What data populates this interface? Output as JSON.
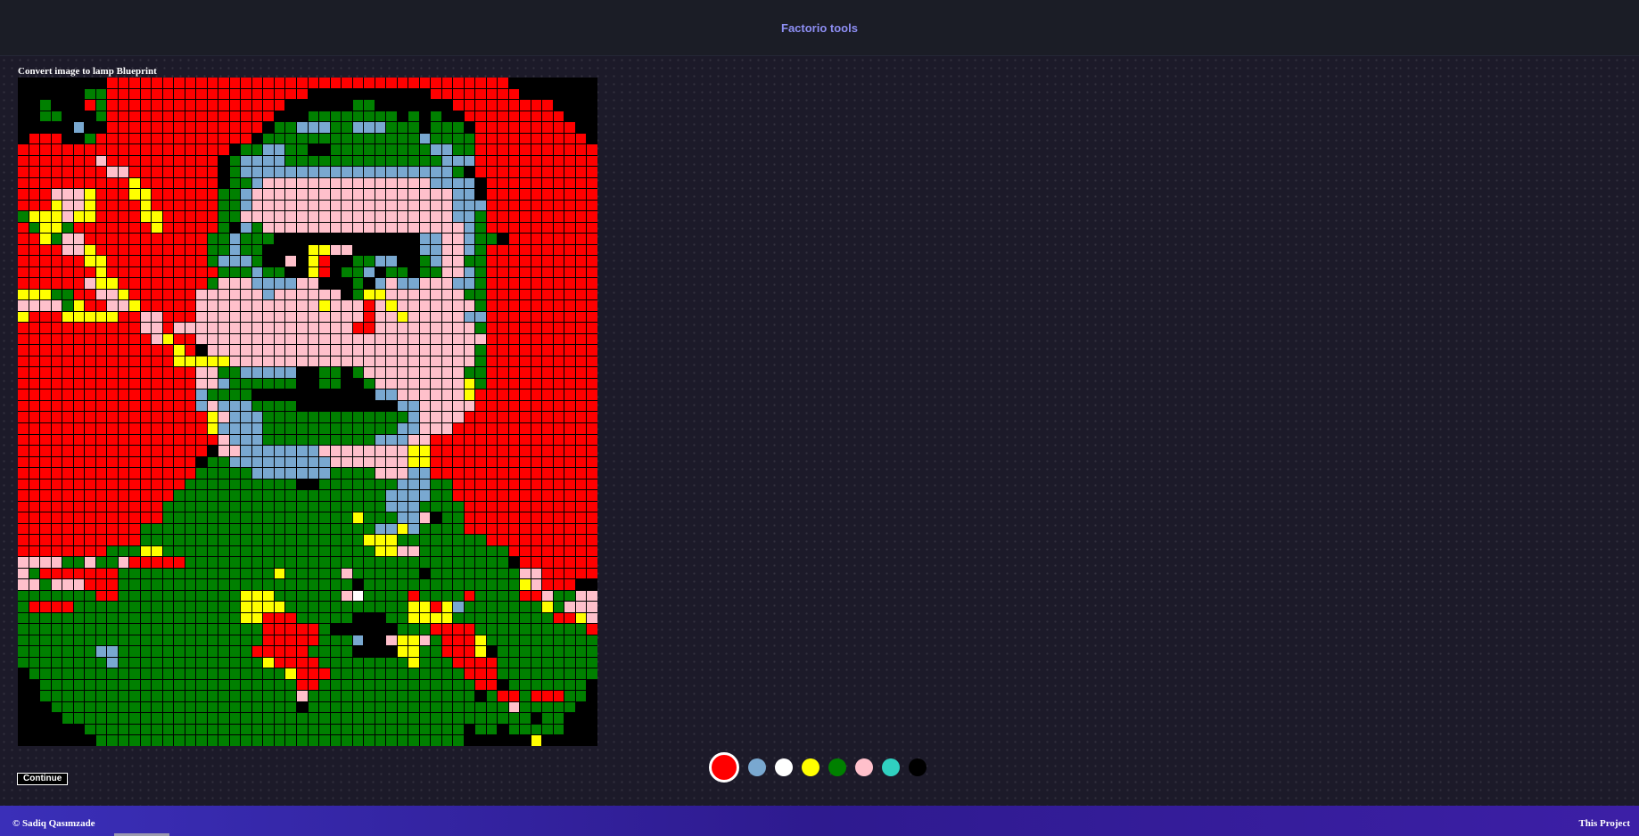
{
  "header": {
    "title": "Factorio tools"
  },
  "section": {
    "title": "Convert image to lamp Blueprint"
  },
  "actions": {
    "continue_label": "Continue"
  },
  "palette": {
    "colors": [
      {
        "name": "red",
        "hex": "#ff0000",
        "selected": true
      },
      {
        "name": "light-blue",
        "hex": "#79a8d0",
        "selected": false
      },
      {
        "name": "white",
        "hex": "#ffffff",
        "selected": false
      },
      {
        "name": "yellow",
        "hex": "#ffff00",
        "selected": false
      },
      {
        "name": "green",
        "hex": "#008000",
        "selected": false
      },
      {
        "name": "pink",
        "hex": "#ffc0cb",
        "selected": false
      },
      {
        "name": "cyan",
        "hex": "#30d0c0",
        "selected": false
      },
      {
        "name": "black",
        "hex": "#000000",
        "selected": false
      }
    ]
  },
  "lamp_grid": {
    "cols": 52,
    "rows": 60,
    "key": {
      "R": "#ff0000",
      "G": "#008000",
      "B": "#79a8d0",
      "Y": "#ffff00",
      "P": "#ffc0cb",
      "W": "#ffffff",
      "K": "#000000"
    },
    "cells": [
      "KKKKKKKKRRRRRRRRRRRRRRRRRRRRRRRRRRRRRRRRRRRRKKKKKKKK",
      "KKKKKKGGRRRRRRRRRRRRRRRRRRKKKKKKKKKKKRRRRRRRRKKKKKKK",
      "KKGKKKRGRRRRRRRRRRRRRRRRKKKKKKGGKKKKKKKRRRRRRRRRKKKK",
      "KKGGKKKGRRRRRRRRRRRRRRRKKKGGGGGGGGKGKGKKRRRRRRRRRKKK",
      "KKKKKBKKRRRRRRRRRRRRRRKGGBBBGGBBBGGGKGGGKRRRRRRRRRKK",
      "KRRRKKGRRRRRRRRRRRRRRKGGGGGGGGGGGGGGBGGGGRRRRRRRRRRK",
      "RRRRRRRRRRRRRRRRRRRKGGBBGGKKGGGGGGGGGBBGGRRRRRRRRRRR",
      "RRRRRRRPRRRRRRRRRRKGBBBBGGGGGGGGGGGGGGBBBRRRRRRRRRRR",
      "RRRRRRRRPPRRRRRRRRKGBBBBBBBBBBBBBBBBBBBGKRRRRRRRRRRR",
      "RRRRRRRRRRYRRRRRRRKGGBPPPPPPPPPPPPPPPBBBBKRRRRRRRRRR",
      "RRRPPPYRRRYYRRRRRRGGBPPPPPPPPPPPPPPPPPPBBKRRRRRRRRRR",
      "RRRYPPYRRRRYRRRRRRGGBPPPPPPPPPPPPPPPPPPBBBRRRRRRRRRR",
      "GYYYPYYRRRRYYRRRRRGGPPPPPPPPPPPPPPPPPPPBBGRRRRRRRRRR",
      "RGYYGRRRRRRRYRRRRRGKBGPPPPPPPPPPPPPPPPPPBGRRRRRRRRRR",
      "RRYGPPRRRRRRRRRRRGGBGGGKKKKKKKKKKKKKBBPPBGGKRRRRRRRR",
      "RRRRPPYRRRRRRRRRRGGBGGKKKKYYPPKKKKKKBBPPBGRRRRRRRRRR",
      "RRRRRRYYRRRRRRRRRGBBBGKKPKYRKKGGBBKKGBPPGGRRRRRRRRRR",
      "RRRRRRRYRRRRRRRRRRGGGBGGKKYRKGGBKGGKGGPPBGRRRRRRRRRR",
      "RRRRRRPYYRRRRRRRRGPPPBBBBPPKKKGKBPBBPPPBBGRRRRRRRRRR",
      "YYYGGRRPPYRRRRRRPPPPPPBPPPPPPKGYYPPPPPPPGGRRRRRRRRRR",
      "PPPPGYRRPPYRRRRRPPPPPPPPPPPYPPPRPYPPPPPPPGRRRRRRRRRR",
      "YRRRYYYYYRRPPRRRPPPPPPPPPPPPPPPRPPYPPPPPBBRRRRRRRRRR",
      "RRRRRRRRRRRPPRPPPPPPPPPPPPPPPPRRPPPPPPPPPGRRRRRRRRRR",
      "RRRRRRRRRRRRPYRRPPPPPPPPPPPPPPPPPPPPPPPPPPRRRRRRRRRR",
      "RRRRRRRRRRRRRRYRKPPPPPPPPPPPPPPPPPPPPPPPPGRRRRRRRRRR",
      "RRRRRRRRRRRRRRYYYYYPPPPPPPPPPPPPPPPPPPPPPGRRRRRRRRRR",
      "RRRRRRRRRRRRRRRRPPGGBBBBBKKGGKGPPPPPPPPPGGRRRRRRRRRR",
      "RRRRRRRRRRRRRRRRPPBGGGGGGKKGGKKGPPPPPPPPYGRRRRRRRRRR",
      "RRRRRRRRRRRRRRRRBGGGGKKKKKKKKKKKBBPPPPPPYRRRRRRRRRRR",
      "RRRRRRRRRRRRRRRRBPBBBGGGGKKKKKKKKKBBPPPPPRRRRRRRRRRR",
      "RRRRRRRRRRRRRRRRRYPBBBGGGGGGGGGGGGGBPPPPRRRRRRRRRRRR",
      "RRRRRRRRRRRRRRRRRYBBBBGGGGGGGGGGGGBBPPPRRRRRRRRRRRRR",
      "RRRRRRRRRRRRRRRRRRPBBBGGGGGGGGGGBBBPPRRRRRRRRRRRRRRR",
      "RRRRRRRRRRRRRRRRRKPPBBBBBBBPPPPPPPPYYRRRRRRRRRRRRRRR",
      "RRRRRRRRRRRRRRRRKGGBBBBBBBBBPPPPPPPYYRRRRRRRRRRRRRRR",
      "RRRRRRRRRRRRRRRRGGGGGBBBBBBBGGGGPPPBBRRRRRRRRRRRRRRR",
      "RRRRRRRRRRRRRRRGGGGGGGGGGKKGGGGGGGBBBGGRRRRRRRRRRRRR",
      "RRRRRRRRRRRRRRGGGGGGGGGGGGGGGGGGGBBBBGGRRRRRRRRRRRRR",
      "RRRRRRRRRRRRRGGGGGGGGGGGGGGGGGGGGBBBGGGGRRRRRRRRRRRR",
      "RRRRRRRRRRRRRGGGGGGGGGGGGGGGGGYGGGBBPKGGRRRRRRRRRRRR",
      "RRRRRRRRRRRGGGGGGGGGGGGGGGGGGGGGBBYBGGGGRRRRRRRRRRRR",
      "RRRRRRRRRRRGGGGGGGGGGGGGGGGGGGGYYYGGGGGGGGRRRRRRRRRR",
      "RRRRRRRRGGGYYGGGGGGGGGGGGGGGGGGGYYPPGGGGGGGGRRRRRRRR",
      "PPPPGGPGGPRRRRRGGGGGGGGGGGGGGGGGGGGGGGGGGGGGKRRRRRRR",
      "PGRRRRRRRGGGGGGGGGGGGGGYGGGGGPGGGGGGKGGGGGGGGPPRRRRR",
      "PPGPPPRRRGGGGGGGGGGGGGGGGGGGGGKGGGGGGGGGGGGGGYPRRRKK",
      "GGGGGGGRRGGGGGGGGGGGYYYGGGGGGPWGGGGRGGGGRGGGGRRPGGPP",
      "GRRRRGGGGGGGGGGGGGGGYYYYGGGGGGGGGGGYYRYBGGGGGGGYGPPP",
      "GGGGGGGGGGGGGGGGGGGGYYRRRGGGGGKKKGGYYYYGGGGGGGGGRRYP",
      "GGGGGGGGGGGGGGGGGGGGGGRRRRRGKKKKKKGGGRRRRGGGGGGGGGGR",
      "GGGGGGGGGGGGGGGGGGGGGGRRRRRGGGBKKPYYPGRRRYGGGGGGGGGG",
      "GGGGGGGBBGGGGGGGGGGGGRRRRRGGGGKKKKYYGGRRRYKGGGGGGGGG",
      "GGGGGGGGBGGGGGGGGGGGGGYRRRRGGGGGGGGYGGGRRRRGGGGGGGGG",
      "KGGGGGGGGGGGGGGGGGGGGGGGYRRRGGGGGGGGGGGGRRRGGGGGGGGG",
      "KKGGGGGGGGGGGGGGGGGGGGGGGRRGGGGGGGGGGGGGGRRKGGGGGGGK",
      "KKGGGGGGGGGGGGGGGGGGGGGGGPGGGGGGGGGGGGGGGKGRRGRRRGGK",
      "KKKGGGGGGGGGGGGGGGGGGGGGGKGGGGGGGGGGGGGGGGGGPGGGGGKK",
      "KKKKGGGGGGGGGGGGGGGGGGGGGGGGGGGGGGGGGGGGGGGGGGKGGKKK",
      "KKKKKKGGGGGGGGGGGGGGGGGGGGGGGGGGGGGGGGGGKGGKGGGGGKKK",
      "KKKKKKKGGGGGGGGGGGGGGGGGGGGGGGGGGGGGGGGGKKKKKKYKKKKK"
    ]
  },
  "footer": {
    "copyright": "© Sadiq Qasımzade",
    "link_label": "This Project"
  }
}
